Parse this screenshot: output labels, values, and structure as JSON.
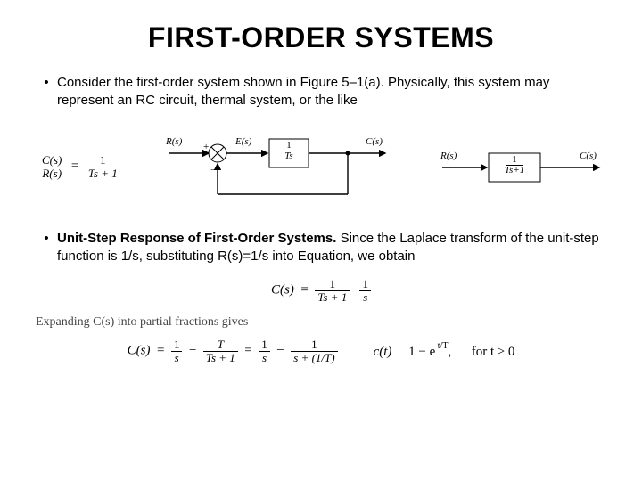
{
  "title": "FIRST-ORDER SYSTEMS",
  "bullets": {
    "b1": "Consider the first-order system shown in Figure 5–1(a). Physically, this system may represent an RC circuit, thermal system, or the like",
    "b2_strong": "Unit-Step Response of First-Order Systems.",
    "b2_rest": " Since the Laplace transform of the unit-step function is 1/s, substituting R(s)=1/s into Equation, we obtain"
  },
  "tf": {
    "lhs_num": "C(s)",
    "lhs_den": "R(s)",
    "eq": "=",
    "rhs_num": "1",
    "rhs_den": "Ts + 1"
  },
  "diagA": {
    "R": "R(s)",
    "E": "E(s)",
    "block_num": "1",
    "block_den": "Ts",
    "C": "C(s)",
    "plus": "+",
    "minus": "−"
  },
  "diagB": {
    "R": "R(s)",
    "block_num": "1",
    "block_den": "Ts+1",
    "C": "C(s)"
  },
  "stepEq": {
    "lhs": "C(s)",
    "eq": "=",
    "f1_num": "1",
    "f1_den": "Ts + 1",
    "f2_num": "1",
    "f2_den": "s"
  },
  "partial": "Expanding C(s) into partial fractions gives",
  "expand": {
    "lhs": "C(s)",
    "eq": "=",
    "t1_num": "1",
    "t1_den": "s",
    "minus": "−",
    "t2_num": "T",
    "t2_den": "Ts + 1",
    "eq2": "=",
    "t3_num": "1",
    "t3_den": "s",
    "t4_num": "1",
    "t4_den": "s + (1/T)"
  },
  "time": {
    "lhs": "c(t)",
    "rhs": "1 − e",
    "exp": " t/T",
    "comma": ",",
    "cond": "for t ≥ 0"
  }
}
